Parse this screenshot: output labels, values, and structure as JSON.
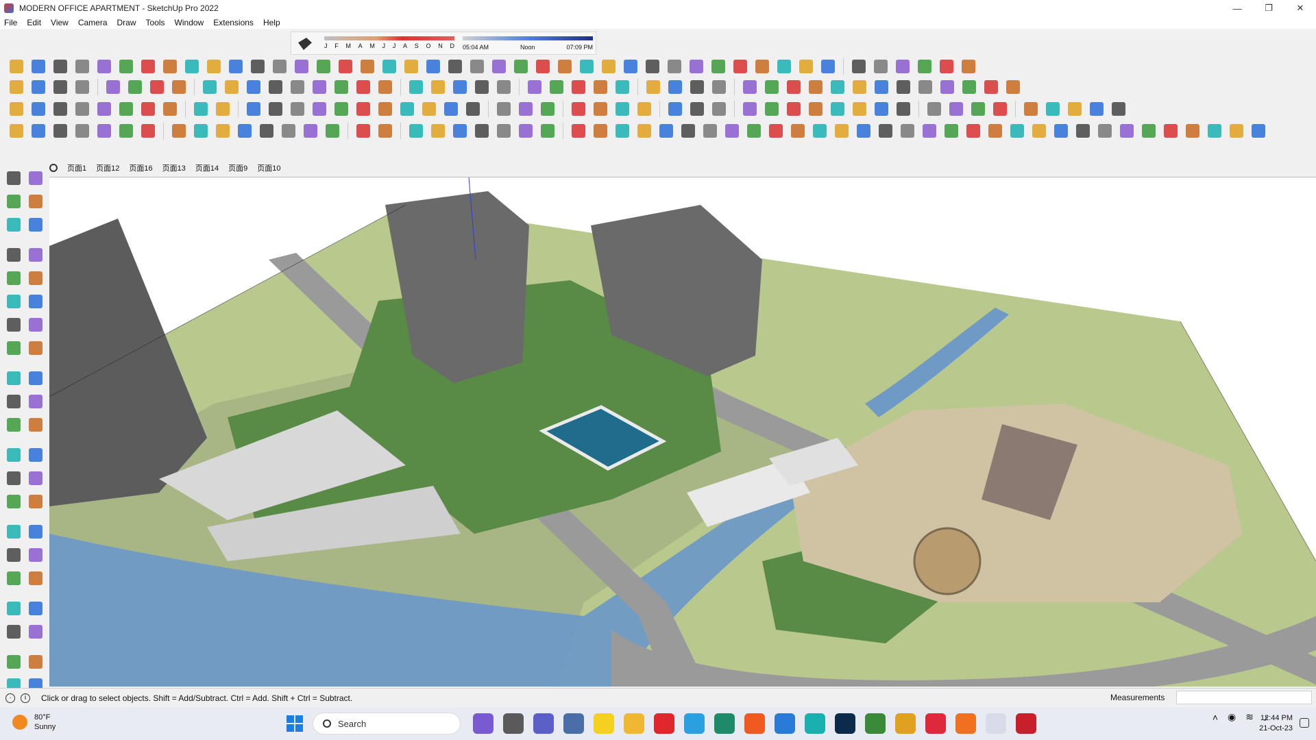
{
  "window": {
    "title": "MODERN OFFICE APARTMENT - SketchUp Pro 2022",
    "minimize": "—",
    "maximize": "❐",
    "close": "✕"
  },
  "menu": [
    "File",
    "Edit",
    "View",
    "Camera",
    "Draw",
    "Tools",
    "Window",
    "Extensions",
    "Help"
  ],
  "shadows": {
    "months": [
      "J",
      "F",
      "M",
      "A",
      "M",
      "J",
      "J",
      "A",
      "S",
      "O",
      "N",
      "D"
    ],
    "time_start": "05:04 AM",
    "time_mid": "Noon",
    "time_end": "07:09 PM"
  },
  "scene_tabs": [
    "页面1",
    "页面12",
    "页面16",
    "页面13",
    "页面14",
    "页面9",
    "页面10"
  ],
  "status": {
    "message": "Click or drag to select objects. Shift = Add/Subtract. Ctrl = Add. Shift + Ctrl = Subtract.",
    "measurements_label": "Measurements",
    "measurements_value": ""
  },
  "taskbar": {
    "temperature": "80°F",
    "condition": "Sunny",
    "search_placeholder": "Search",
    "time": "12:44 PM",
    "date": "21-Oct-23"
  },
  "colors": {
    "grass": "#5a8b46",
    "ground": "#b9c98e",
    "water": "#6f9ac6",
    "road": "#9a9a9a",
    "pool": "#1f6c8c",
    "accent_red": "#e0282c",
    "accent_blue": "#2a6fd8"
  }
}
